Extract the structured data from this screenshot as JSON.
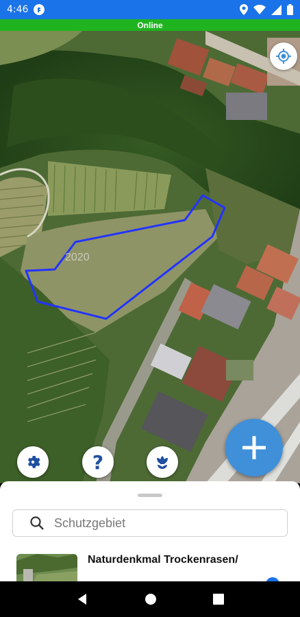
{
  "status_bar": {
    "time": "4:46",
    "icons": [
      "app-notification-icon",
      "location-icon",
      "wifi-icon",
      "signal-icon",
      "battery-icon"
    ]
  },
  "connection": {
    "label": "Online",
    "color": "#1fb41f"
  },
  "map": {
    "overlay_text": "2020",
    "polygon_color": "#2233ff",
    "controls": [
      "locate-icon",
      "settings-icon",
      "help-icon",
      "flower-icon"
    ]
  },
  "help_button": {
    "label": "?"
  },
  "add_button": {
    "icon": "plus-icon",
    "color": "#3f8fd9"
  },
  "bottom_sheet": {
    "search": {
      "placeholder": "Schutzgebiet",
      "value": ""
    },
    "results": [
      {
        "title": "Naturdenkmal Trockenrasen/"
      }
    ]
  },
  "nav_bar": {
    "icons": [
      "back-icon",
      "home-icon",
      "recents-icon"
    ]
  }
}
